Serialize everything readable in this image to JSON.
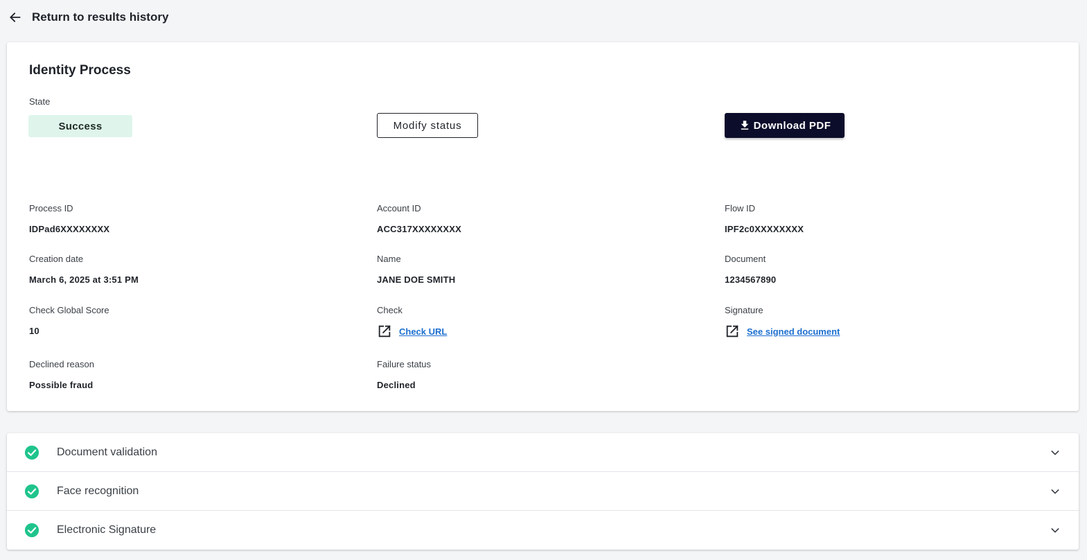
{
  "header": {
    "back_label": "Return to results history"
  },
  "process": {
    "title": "Identity Process",
    "state_label": "State",
    "state_value": "Success",
    "modify_label": "Modify status",
    "download_label": "Download PDF"
  },
  "fields": {
    "process_id": {
      "label": "Process ID",
      "value": "IDPad6XXXXXXXX"
    },
    "account_id": {
      "label": "Account ID",
      "value": "ACC317XXXXXXXX"
    },
    "flow_id": {
      "label": "Flow ID",
      "value": "IPF2c0XXXXXXXX"
    },
    "creation_date": {
      "label": "Creation date",
      "value": "March 6, 2025 at 3:51 PM"
    },
    "name": {
      "label": "Name",
      "value": "JANE DOE SMITH"
    },
    "document": {
      "label": "Document",
      "value": "1234567890"
    },
    "check_score": {
      "label": "Check Global Score",
      "value": "10"
    },
    "check": {
      "label": "Check",
      "link": "Check URL"
    },
    "signature": {
      "label": "Signature",
      "link": "See signed document"
    },
    "declined_reason": {
      "label": "Declined reason",
      "value": "Possible fraud"
    },
    "failure_status": {
      "label": "Failure status",
      "value": "Declined"
    }
  },
  "sections": [
    {
      "label": "Document validation",
      "icon": "check-circle-icon",
      "status_color": "#1fc48c"
    },
    {
      "label": "Face recognition",
      "icon": "check-circle-icon",
      "status_color": "#1fc48c"
    },
    {
      "label": "Electronic Signature",
      "icon": "check-circle-icon",
      "status_color": "#1fc48c"
    }
  ],
  "colors": {
    "accent_dark": "#0c0d2b",
    "success_bg": "#dff5ec",
    "link": "#1d6fcf"
  }
}
